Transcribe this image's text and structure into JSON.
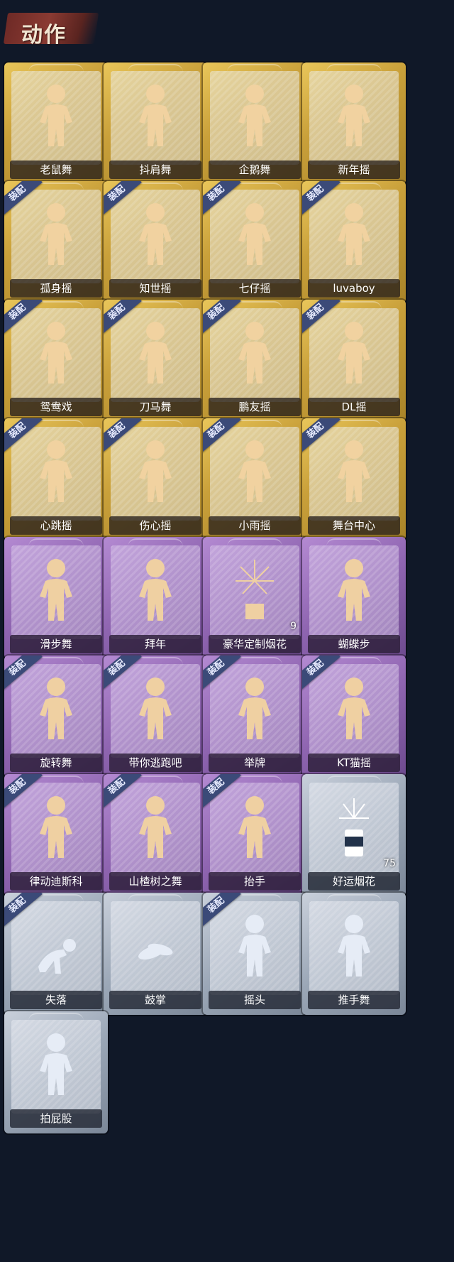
{
  "header": {
    "title": "动作"
  },
  "colors": {
    "gold": "#d4ad45",
    "purple": "#9a6fbd",
    "silver": "#aeb8c6",
    "equip_badge": "#3b4a78"
  },
  "equip_label": "装配",
  "cards": [
    {
      "label": "老鼠舞",
      "rarity": "gold",
      "equipped": false,
      "figure": "dance-figure-icon"
    },
    {
      "label": "抖肩舞",
      "rarity": "gold",
      "equipped": false,
      "figure": "dance-figure-icon"
    },
    {
      "label": "企鹅舞",
      "rarity": "gold",
      "equipped": false,
      "figure": "dance-figure-icon"
    },
    {
      "label": "新年摇",
      "rarity": "gold",
      "equipped": false,
      "figure": "dance-figure-icon"
    },
    {
      "label": "孤身摇",
      "rarity": "gold",
      "equipped": true,
      "figure": "dance-figure-icon"
    },
    {
      "label": "知世摇",
      "rarity": "gold",
      "equipped": true,
      "figure": "dance-figure-icon"
    },
    {
      "label": "七仔摇",
      "rarity": "gold",
      "equipped": true,
      "figure": "dance-figure-icon"
    },
    {
      "label": "luvaboy",
      "rarity": "gold",
      "equipped": true,
      "figure": "dance-figure-icon"
    },
    {
      "label": "鸳鸯戏",
      "rarity": "gold",
      "equipped": true,
      "figure": "dance-figure-icon"
    },
    {
      "label": "刀马舞",
      "rarity": "gold",
      "equipped": true,
      "figure": "dance-figure-icon"
    },
    {
      "label": "鹏友摇",
      "rarity": "gold",
      "equipped": true,
      "figure": "dance-figure-icon"
    },
    {
      "label": "DL摇",
      "rarity": "gold",
      "equipped": true,
      "figure": "dance-figure-icon"
    },
    {
      "label": "心跳摇",
      "rarity": "gold",
      "equipped": true,
      "figure": "dance-figure-icon"
    },
    {
      "label": "伤心摇",
      "rarity": "gold",
      "equipped": true,
      "figure": "heart-hands-figure-icon"
    },
    {
      "label": "小雨摇",
      "rarity": "gold",
      "equipped": true,
      "figure": "dance-figure-icon"
    },
    {
      "label": "舞台中心",
      "rarity": "gold",
      "equipped": true,
      "figure": "dance-figure-icon"
    },
    {
      "label": "滑步舞",
      "rarity": "purple",
      "equipped": false,
      "figure": "dance-figure-icon"
    },
    {
      "label": "拜年",
      "rarity": "purple",
      "equipped": false,
      "figure": "greeting-figure-icon"
    },
    {
      "label": "豪华定制烟花",
      "rarity": "purple",
      "equipped": false,
      "figure": "fireworks-box-icon",
      "count": "9"
    },
    {
      "label": "蝴蝶步",
      "rarity": "purple",
      "equipped": false,
      "figure": "dance-figure-icon"
    },
    {
      "label": "旋转舞",
      "rarity": "purple",
      "equipped": true,
      "figure": "dance-figure-icon"
    },
    {
      "label": "带你逃跑吧",
      "rarity": "purple",
      "equipped": true,
      "figure": "dance-figure-icon"
    },
    {
      "label": "举牌",
      "rarity": "purple",
      "equipped": true,
      "figure": "sign-holding-figure-icon"
    },
    {
      "label": "KT猫摇",
      "rarity": "purple",
      "equipped": true,
      "figure": "dance-figure-icon"
    },
    {
      "label": "律动迪斯科",
      "rarity": "purple",
      "equipped": true,
      "figure": "dance-figure-icon"
    },
    {
      "label": "山楂树之舞",
      "rarity": "purple",
      "equipped": true,
      "figure": "dance-figure-icon"
    },
    {
      "label": "抬手",
      "rarity": "purple",
      "equipped": true,
      "figure": "raise-hand-figure-icon"
    },
    {
      "label": "好运烟花",
      "rarity": "silver",
      "equipped": false,
      "figure": "firework-can-icon",
      "count": "75"
    },
    {
      "label": "失落",
      "rarity": "silver",
      "equipped": true,
      "figure": "crawling-figure-icon"
    },
    {
      "label": "鼓掌",
      "rarity": "silver",
      "equipped": false,
      "figure": "clapping-hands-icon"
    },
    {
      "label": "摇头",
      "rarity": "silver",
      "equipped": true,
      "figure": "dance-figure-icon"
    },
    {
      "label": "推手舞",
      "rarity": "silver",
      "equipped": false,
      "figure": "dance-figure-icon"
    },
    {
      "label": "拍屁股",
      "rarity": "silver",
      "equipped": false,
      "figure": "dance-figure-icon"
    }
  ]
}
